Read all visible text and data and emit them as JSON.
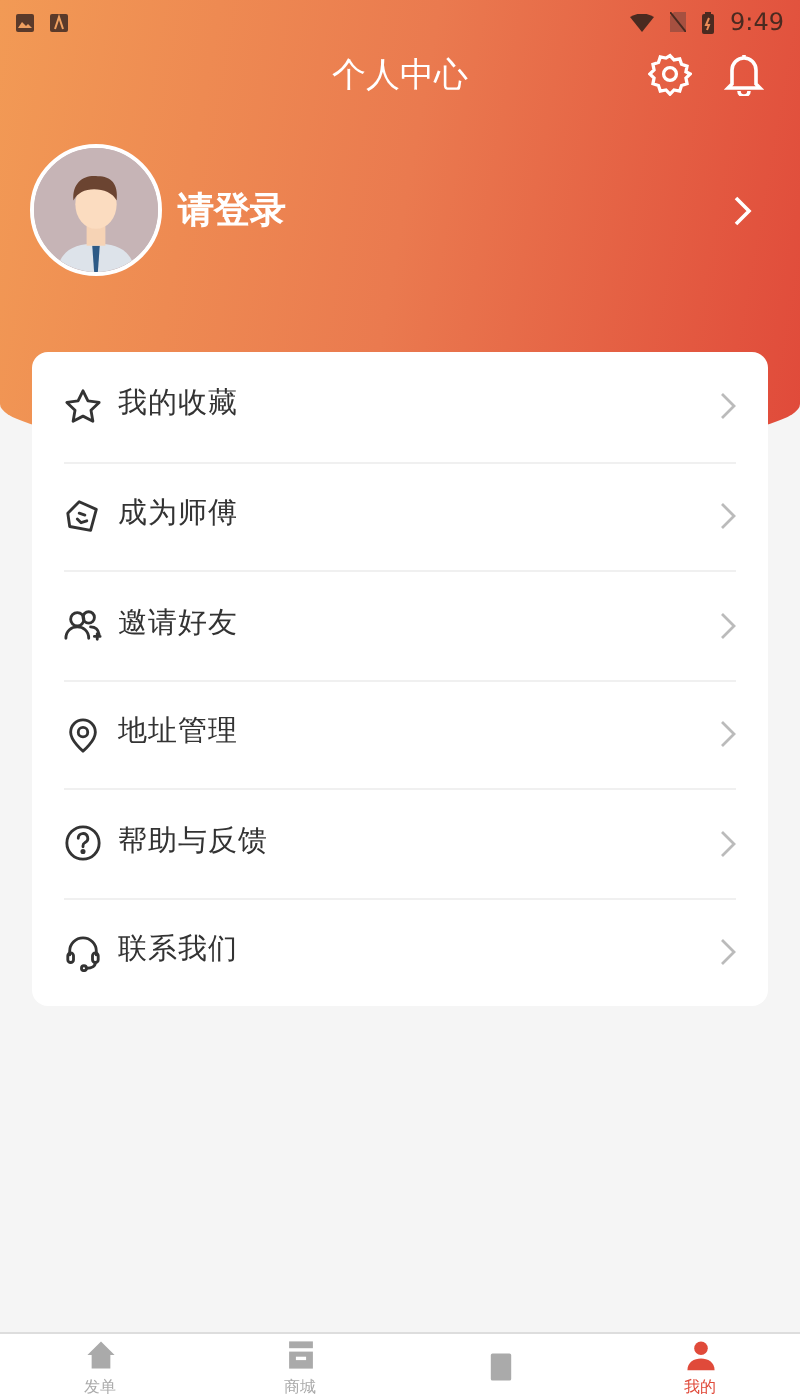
{
  "status_bar": {
    "time": "9:49"
  },
  "header": {
    "title": "个人中心"
  },
  "profile": {
    "name": "请登录"
  },
  "menu": [
    {
      "kind": "star",
      "label": "我的收藏"
    },
    {
      "kind": "tag",
      "label": "成为师傅"
    },
    {
      "kind": "people",
      "label": "邀请好友"
    },
    {
      "kind": "pin",
      "label": "地址管理"
    },
    {
      "kind": "help",
      "label": "帮助与反馈"
    },
    {
      "kind": "headset",
      "label": "联系我们"
    }
  ],
  "tab_bar": [
    {
      "kind": "home",
      "label": "发单",
      "selected": false
    },
    {
      "kind": "store",
      "label": "商城",
      "selected": false
    },
    {
      "kind": "doc",
      "selected": false
    },
    {
      "kind": "person",
      "label": "我的",
      "selected": true
    }
  ]
}
